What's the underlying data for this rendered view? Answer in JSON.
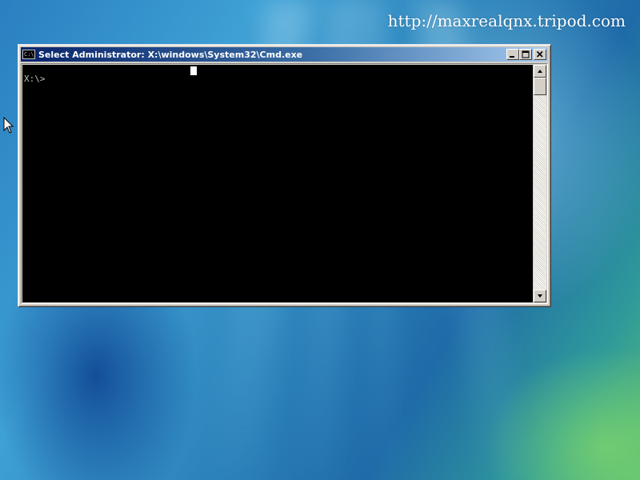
{
  "desktop": {
    "watermark": "http://maxrealqnx.tripod.com"
  },
  "window": {
    "title": "Select Administrator: X:\\windows\\System32\\Cmd.exe",
    "icon_text": "C:\\",
    "buttons": {
      "minimize": "minimize-icon",
      "maximize": "maximize-icon",
      "close": "close-icon"
    }
  },
  "console": {
    "prompt": "X:\\>",
    "text_color": "#c0c0c0",
    "background": "#000000"
  },
  "scrollbar": {
    "up": "arrow-up-icon",
    "down": "arrow-down-icon"
  },
  "colors": {
    "titlebar_start": "#0a246a",
    "titlebar_end": "#a6caf0",
    "chrome": "#d4d0c8"
  }
}
